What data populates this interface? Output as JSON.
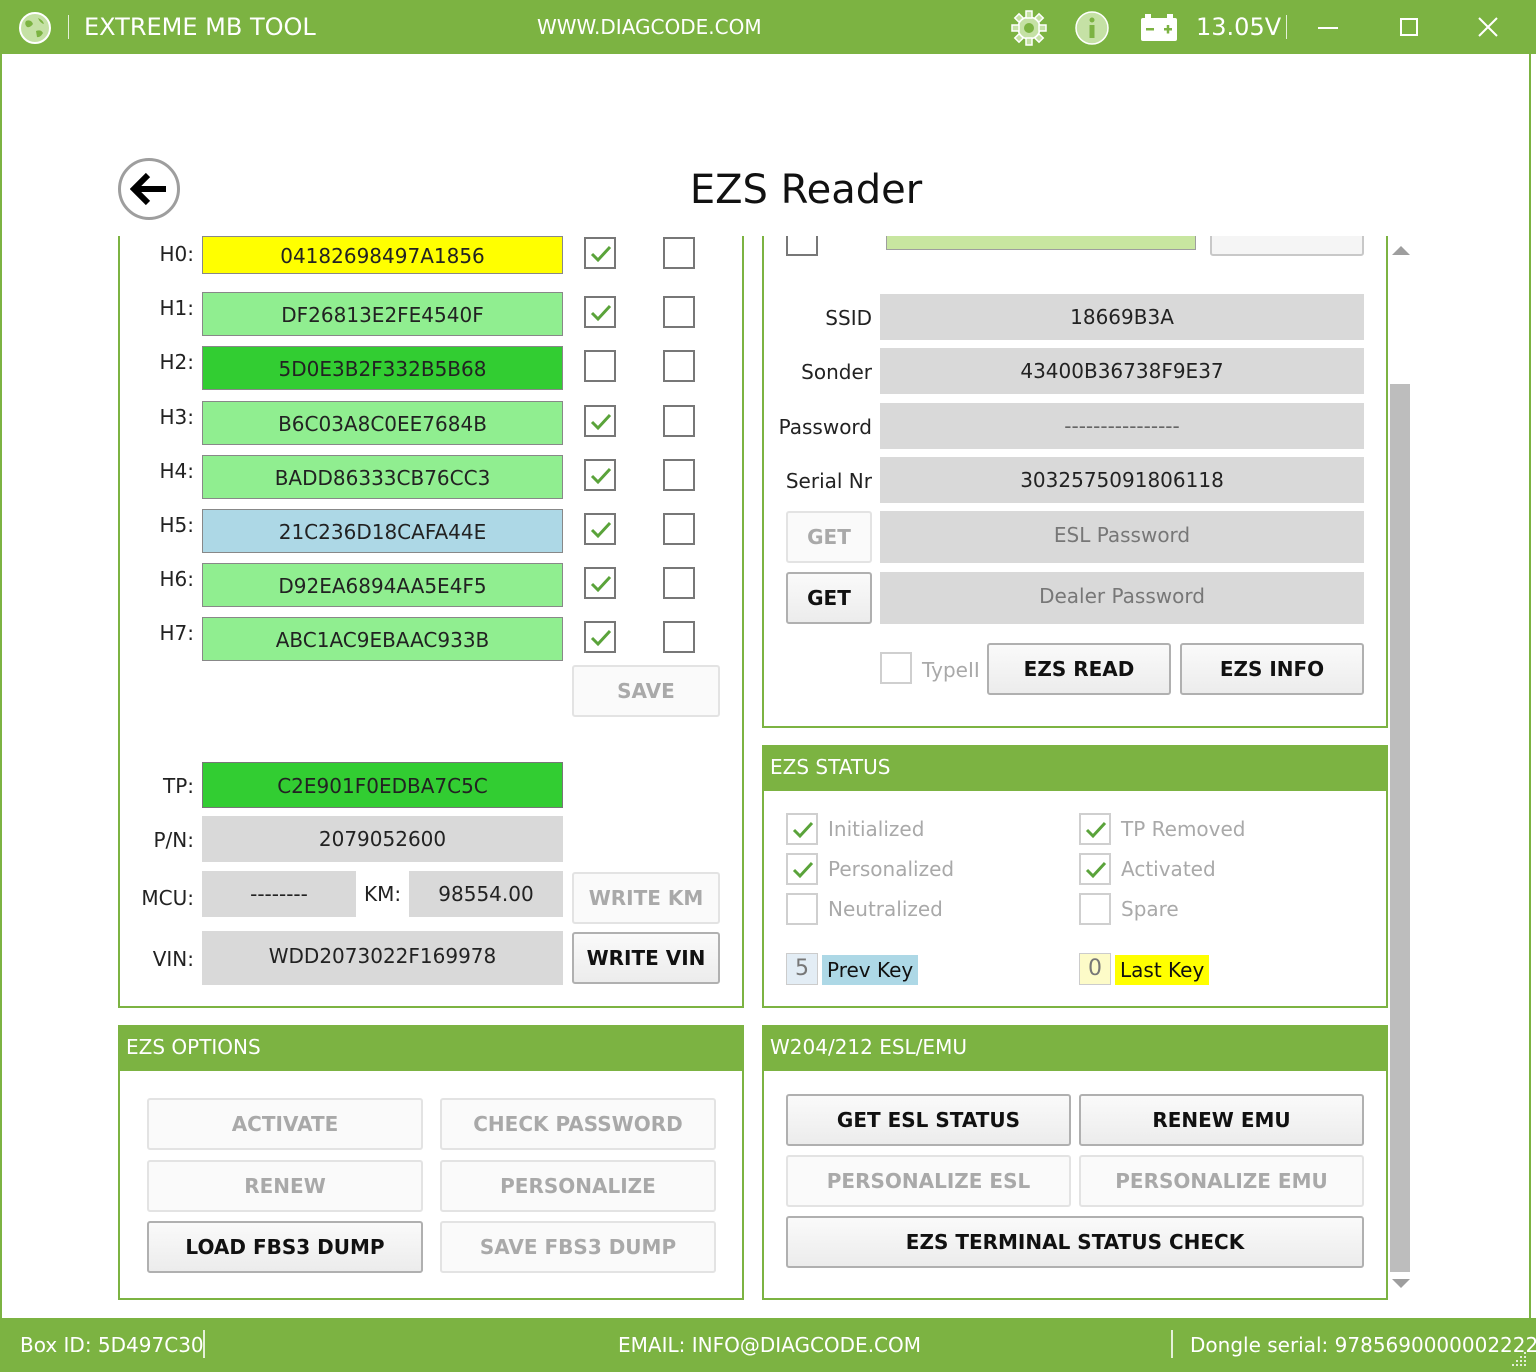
{
  "app": {
    "title": "EXTREME MB TOOL",
    "website": "WWW.DIAGCODE.COM",
    "voltage": "13.05V",
    "icons": [
      "globe-icon",
      "gear-icon",
      "info-icon",
      "battery-icon",
      "minimize-icon",
      "maximize-icon",
      "close-icon"
    ]
  },
  "page": {
    "title": "EZS Reader"
  },
  "hashes": [
    {
      "label": "H0:",
      "value": "04182698497A1856",
      "bg": "#ffff00",
      "check1": true,
      "check2": false
    },
    {
      "label": "H1:",
      "value": "DF26813E2FE4540F",
      "bg": "#90ee90",
      "check1": true,
      "check2": false
    },
    {
      "label": "H2:",
      "value": "5D0E3B2F332B5B68",
      "bg": "#32cd32",
      "check1": false,
      "check2": false
    },
    {
      "label": "H3:",
      "value": "B6C03A8C0EE7684B",
      "bg": "#90ee90",
      "check1": true,
      "check2": false
    },
    {
      "label": "H4:",
      "value": "BADD86333CB76CC3",
      "bg": "#90ee90",
      "check1": true,
      "check2": false
    },
    {
      "label": "H5:",
      "value": "21C236D18CAFA44E",
      "bg": "#add8e6",
      "check1": true,
      "check2": false
    },
    {
      "label": "H6:",
      "value": "D92EA6894AA5E4F5",
      "bg": "#90ee90",
      "check1": true,
      "check2": false
    },
    {
      "label": "H7:",
      "value": "ABC1AC9EBAAC933B",
      "bg": "#90ee90",
      "check1": true,
      "check2": false
    }
  ],
  "left": {
    "save_label": "SAVE",
    "tp_label": "TP:",
    "tp_value": "C2E901F0EDBA7C5C",
    "tp_bg": "#32cd32",
    "pn_label": "P/N:",
    "pn_value": "2079052600",
    "mcu_label": "MCU:",
    "mcu_value": "--------",
    "km_label": "KM:",
    "km_value": "98554.00",
    "write_km_label": "WRITE KM",
    "vin_label": "VIN:",
    "vin_value": "WDD2073022F169978",
    "write_vin_label": "WRITE VIN"
  },
  "right": {
    "ssid_label": "SSID",
    "ssid_value": "18669B3A",
    "sonder_label": "Sonder",
    "sonder_value": "43400B36738F9E37",
    "password_label": "Password",
    "password_value": "----------------",
    "serial_label": "Serial Nr",
    "serial_value": "3032575091806118",
    "get_label": "GET",
    "esl_password_placeholder": "ESL Password",
    "dealer_password_placeholder": "Dealer Password",
    "type1_label": "TypeII",
    "ezs_read_label": "EZS READ",
    "ezs_info_label": "EZS INFO"
  },
  "ezs_status": {
    "header": "EZS STATUS",
    "initialized": "Initialized",
    "personalized": "Personalized",
    "neutralized": "Neutralized",
    "tp_removed": "TP Removed",
    "activated": "Activated",
    "spare": "Spare",
    "prev_key_num": "5",
    "prev_key_label": "Prev Key",
    "prev_key_color": "#add8e6",
    "last_key_num": "0",
    "last_key_label": "Last Key",
    "last_key_color": "#ffff00"
  },
  "ezs_options": {
    "header": "EZS OPTIONS",
    "activate": "ACTIVATE",
    "check_password": "CHECK PASSWORD",
    "renew": "RENEW",
    "personalize": "PERSONALIZE",
    "load_dump": "LOAD FBS3 DUMP",
    "save_dump": "SAVE FBS3 DUMP"
  },
  "esl_emu": {
    "header": "W204/212 ESL/EMU",
    "get_esl_status": "GET ESL STATUS",
    "renew_emu": "RENEW EMU",
    "personalize_esl": "PERSONALIZE ESL",
    "personalize_emu": "PERSONALIZE EMU",
    "terminal_check": "EZS TERMINAL STATUS CHECK"
  },
  "status": {
    "box_id": "Box ID: 5D497C30",
    "email": "EMAIL: INFO@DIAGCODE.COM",
    "dongle": "Dongle serial: 9785690000002222"
  },
  "colors": {
    "accent": "#7cb342",
    "check": "#5aa33a"
  }
}
